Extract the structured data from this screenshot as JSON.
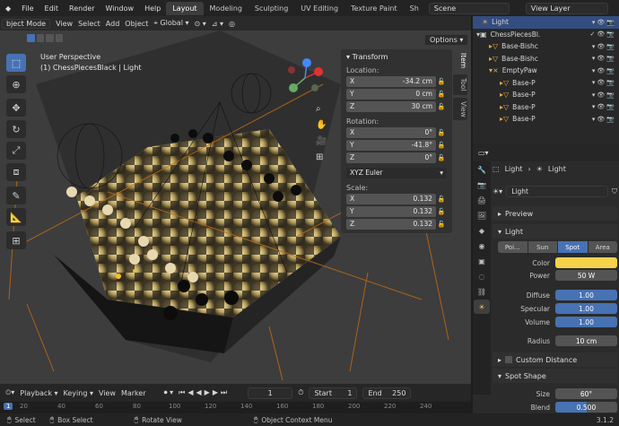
{
  "menus": [
    "bject Mode",
    "File",
    "Edit",
    "Render",
    "Window",
    "Help"
  ],
  "workspaces": [
    "Layout",
    "Modeling",
    "Sculpting",
    "UV Editing",
    "Texture Paint",
    "Sh"
  ],
  "scene": "Scene",
  "view_layer": "View Layer",
  "vp_header": {
    "mode": "bject Mode",
    "items": [
      "View",
      "Select",
      "Add",
      "Object"
    ],
    "transform": "Global"
  },
  "vp_overlay": {
    "persp": "User Perspective",
    "object": "(1) ChessPiecesBlack | Light",
    "options": "Options"
  },
  "npanel": {
    "title": "Transform",
    "location_label": "Location:",
    "location": [
      [
        "X",
        "-34.2 cm"
      ],
      [
        "Y",
        "0 cm"
      ],
      [
        "Z",
        "30 cm"
      ]
    ],
    "rotation_label": "Rotation:",
    "rotation": [
      [
        "X",
        "0°"
      ],
      [
        "Y",
        "-41.8°"
      ],
      [
        "Z",
        "0°"
      ]
    ],
    "euler": "XYZ Euler",
    "scale_label": "Scale:",
    "scale": [
      [
        "X",
        "0.132"
      ],
      [
        "Y",
        "0.132"
      ],
      [
        "Z",
        "0.132"
      ]
    ]
  },
  "side_tabs": [
    "Item",
    "Tool",
    "View"
  ],
  "timeline": {
    "items": [
      "Playback",
      "Keying",
      "View",
      "Marker"
    ],
    "current": "1",
    "start_label": "Start",
    "start": "1",
    "end_label": "End",
    "end": "250"
  },
  "ruler": [
    "20",
    "40",
    "60",
    "80",
    "100",
    "120",
    "140",
    "160",
    "180",
    "200",
    "220",
    "240"
  ],
  "status": {
    "select": "Select",
    "box": "Box Select",
    "rotate": "Rotate View",
    "ctx": "Object Context Menu",
    "version": "3.1.2"
  },
  "outliner": [
    {
      "label": "Light",
      "indent": 10,
      "selected": true
    },
    {
      "label": "ChessPiecesBl.",
      "indent": 4,
      "selected": false
    },
    {
      "label": "Base-Bishc",
      "indent": 18,
      "selected": false
    },
    {
      "label": "Base-Bishc",
      "indent": 18,
      "selected": false
    },
    {
      "label": "EmptyPaw",
      "indent": 18,
      "selected": false
    },
    {
      "label": "Base-P",
      "indent": 30,
      "selected": false
    },
    {
      "label": "Base-P",
      "indent": 30,
      "selected": false
    },
    {
      "label": "Base-P",
      "indent": 30,
      "selected": false
    },
    {
      "label": "Base-P",
      "indent": 30,
      "selected": false
    }
  ],
  "props": {
    "crumb1": "Light",
    "crumb2": "Light",
    "name": "Light",
    "preview": "Preview",
    "light": "Light",
    "types": [
      "Poi...",
      "Sun",
      "Spot",
      "Area"
    ],
    "color_label": "Color",
    "color": "#f5d24a",
    "rows": [
      [
        "Power",
        "50 W",
        "gray"
      ],
      [
        "Diffuse",
        "1.00",
        "blue"
      ],
      [
        "Specular",
        "1.00",
        "blue"
      ],
      [
        "Volume",
        "1.00",
        "blue"
      ],
      [
        "Radius",
        "10 cm",
        "gray"
      ]
    ],
    "custom": "Custom Distance",
    "spot_shape": "Spot Shape",
    "size_label": "Size",
    "size": "60°",
    "blend_label": "Blend",
    "blend": "0.500",
    "blend_fraction": 0.5
  }
}
